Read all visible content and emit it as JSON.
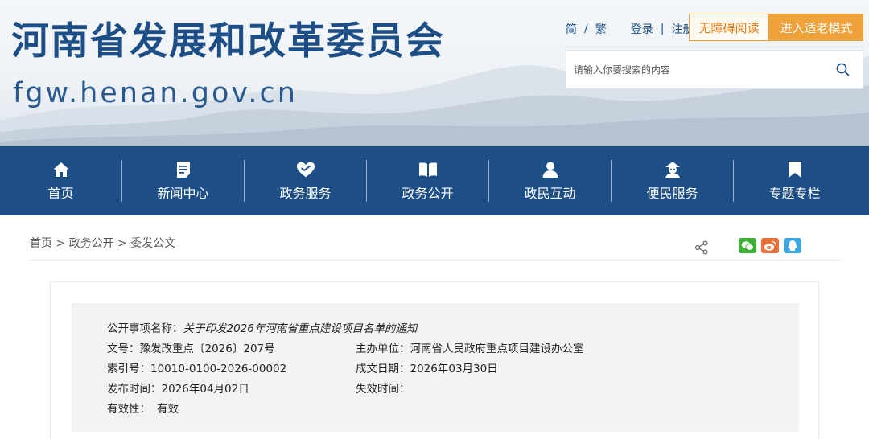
{
  "header": {
    "site_title": "河南省发展和改革委员会",
    "site_domain": "fgw.henan.gov.cn",
    "lang_simplified": "简",
    "lang_traditional": "繁",
    "login": "登录",
    "register": "注册",
    "accessible_reading": "无障碍阅读",
    "elder_mode": "进入适老模式",
    "search_placeholder": "请输入你要搜索的内容"
  },
  "nav": {
    "items": [
      {
        "label": "首页",
        "icon": "home-icon"
      },
      {
        "label": "新闻中心",
        "icon": "news-icon"
      },
      {
        "label": "政务服务",
        "icon": "service-heart-icon"
      },
      {
        "label": "政务公开",
        "icon": "open-book-icon"
      },
      {
        "label": "政民互动",
        "icon": "user-icon"
      },
      {
        "label": "便民服务",
        "icon": "convenience-user-icon"
      },
      {
        "label": "专题专栏",
        "icon": "bookmark-icon"
      }
    ]
  },
  "breadcrumb": {
    "home": "首页",
    "sep": ">",
    "level1": "政务公开",
    "current": "委发公文"
  },
  "info": {
    "item_name_label": "公开事项名称：",
    "item_name_value": "关于印发2026年河南省重点建设项目名单的通知",
    "doc_no_label": "文号：",
    "doc_no_value": "豫发改重点〔2026〕207号",
    "sponsor_label": "主办单位：",
    "sponsor_value": "河南省人民政府重点项目建设办公室",
    "index_label": "索引号：",
    "index_value": "10010-0100-2026-00002",
    "date_label": "成文日期：",
    "date_value": "2026年03月30日",
    "publish_label": "发布时间：",
    "publish_value": "2026年04月02日",
    "expire_label": "失效时间：",
    "expire_value": "",
    "validity_label": "有效性：",
    "validity_value": "有效"
  },
  "colors": {
    "brand_blue": "#1d4f86",
    "accent_orange": "#f0a23a",
    "panel_gray": "#f3f3f3"
  }
}
